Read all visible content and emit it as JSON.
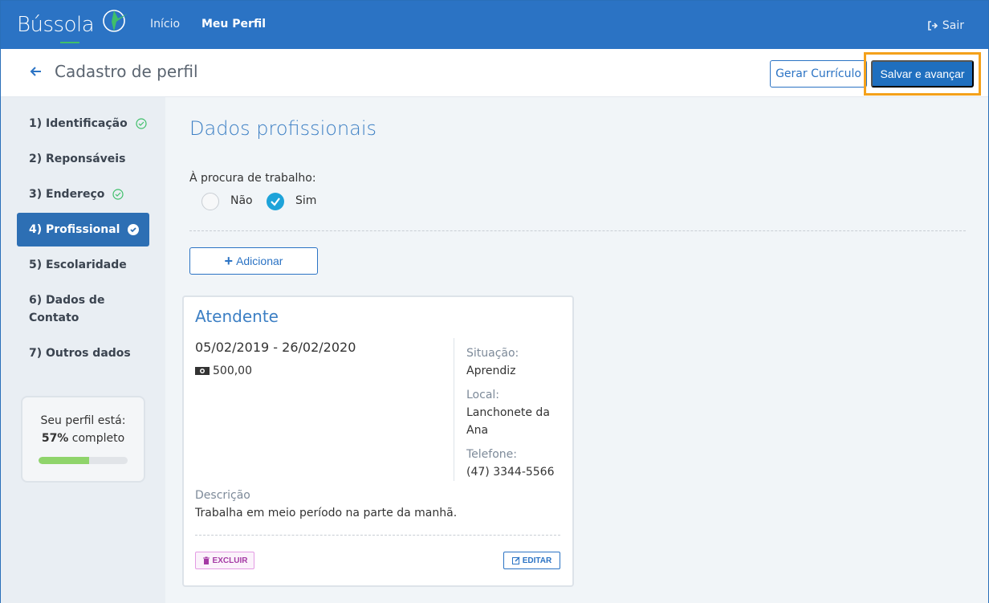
{
  "nav": {
    "logo": "Bússola",
    "links": [
      "Início",
      "Meu Perfil"
    ],
    "logout": "Sair"
  },
  "header": {
    "title": "Cadastro de perfil",
    "curriculo_label": "Gerar Currículo",
    "salvar_label": "Salvar e avançar"
  },
  "sidebar": {
    "steps": [
      {
        "label": "1) Identificação",
        "done": true
      },
      {
        "label": "2) Reponsáveis",
        "done": false
      },
      {
        "label": "3) Endereço",
        "done": true
      },
      {
        "label": "4) Profissional",
        "done": true,
        "active": true
      },
      {
        "label": "5) Escolaridade",
        "done": false
      },
      {
        "label": "6) Dados de Contato",
        "done": false
      },
      {
        "label": "7) Outros dados",
        "done": false
      }
    ],
    "progress": {
      "line1": "Seu perfil está:",
      "percent": "57%",
      "suffix": "completo",
      "value": 57
    }
  },
  "main": {
    "section_title": "Dados profissionais",
    "question": "À procura de trabalho:",
    "option_no": "Não",
    "option_yes": "Sim",
    "selected": "Sim",
    "add_label": "Adicionar"
  },
  "job": {
    "title": "Atendente",
    "dates": "05/02/2019 - 26/02/2020",
    "salary": "500,00",
    "situacao_label": "Situação:",
    "situacao": "Aprendiz",
    "local_label": "Local:",
    "local": "Lanchonete da Ana",
    "telefone_label": "Telefone:",
    "telefone": "(47) 3344-5566",
    "descricao_label": "Descrição",
    "descricao": "Trabalha em meio período na parte da manhã.",
    "excluir_label": "EXCLUIR",
    "editar_label": "EDITAR"
  },
  "colors": {
    "brand": "#2b73c4",
    "highlight": "#f4a11b",
    "success": "#3fbf6a",
    "radio_checked": "#1ea3d9"
  }
}
